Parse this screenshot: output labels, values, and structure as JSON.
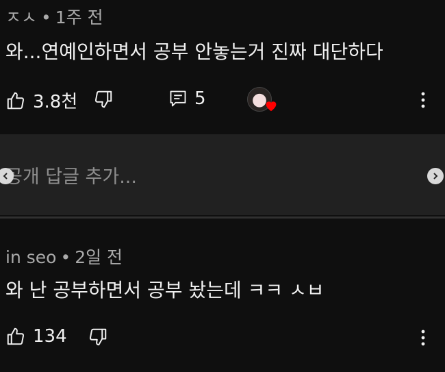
{
  "comments": [
    {
      "author": "ㅈㅅ",
      "time": "1주 전",
      "text": "와...연예인하면서 공부 안놓는거 진짜 대단하다",
      "likes": "3.8천",
      "replies": "5"
    },
    {
      "author": "in seo",
      "time": "2일 전",
      "text": "와 난 공부하면서 공부 놨는데 ㅋㅋ ㅅㅂ",
      "likes": "134"
    }
  ],
  "reply_box": {
    "placeholder": "공개 답글 추가..."
  },
  "meta_separator": "•",
  "icons": {
    "like": "thumbs-up-icon",
    "dislike": "thumbs-down-icon",
    "replies": "comment-icon",
    "more": "more-vert-icon",
    "creator_heart": "heart-icon"
  },
  "colors": {
    "background": "#0f0f0f",
    "reply_box": "#212121",
    "heart": "#ff0000"
  }
}
